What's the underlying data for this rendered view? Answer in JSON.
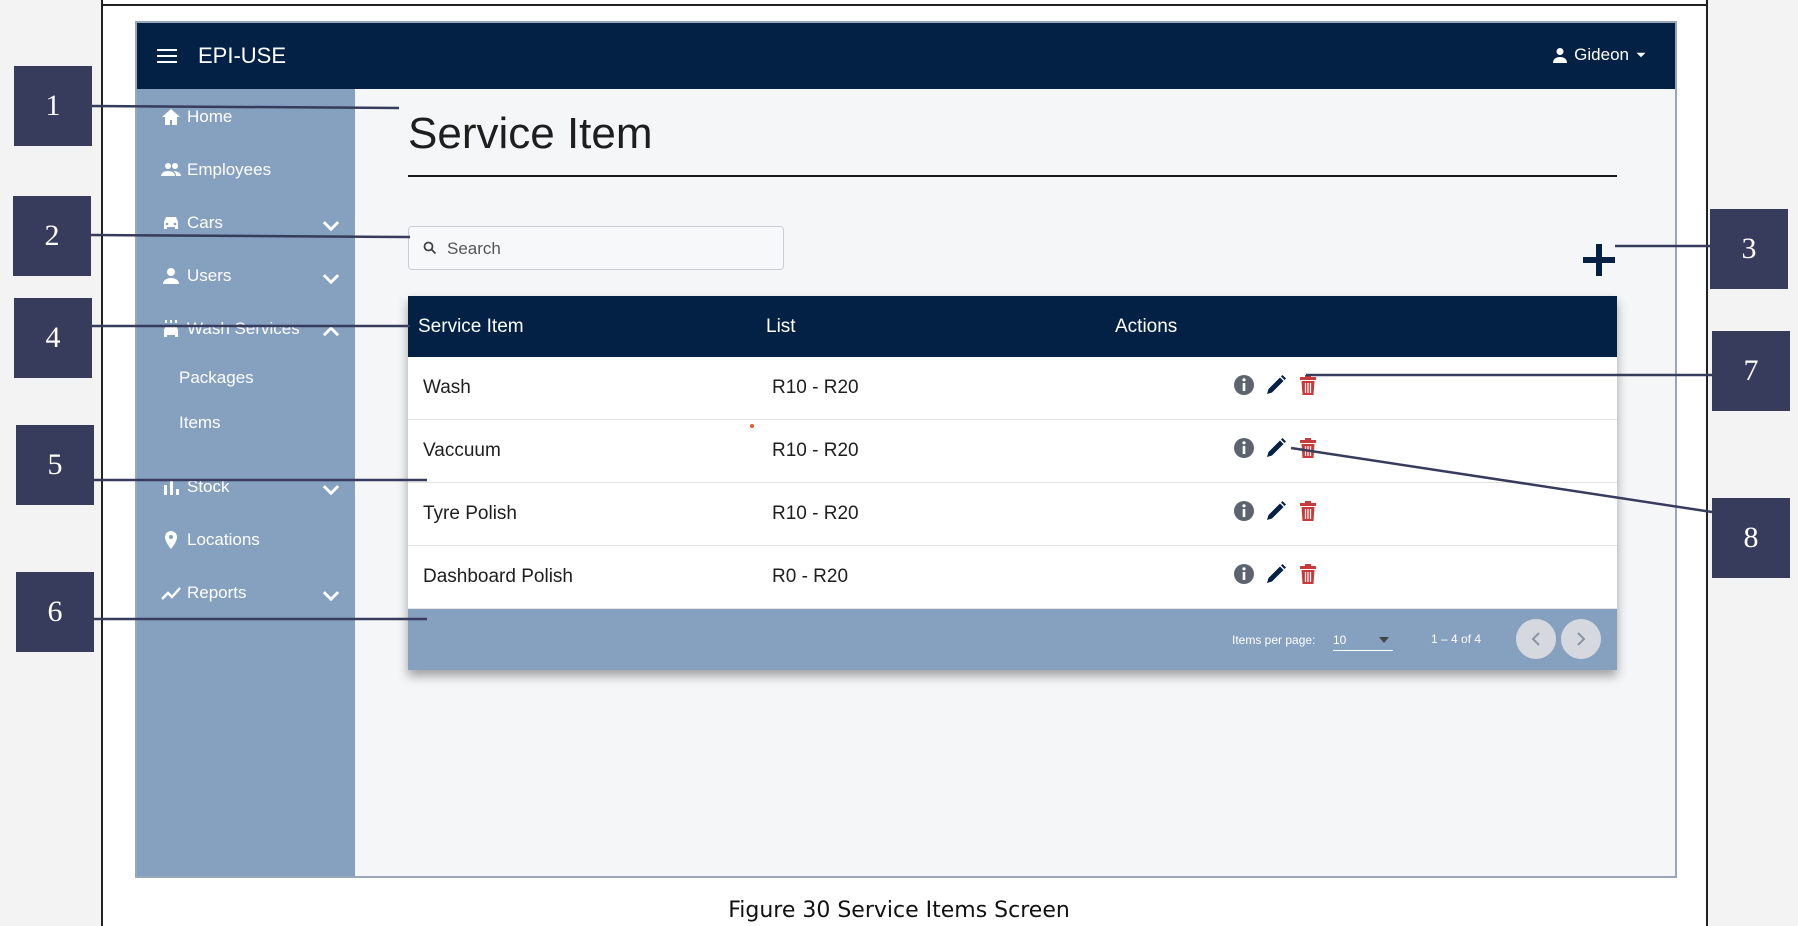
{
  "app": {
    "brand": "EPI-USE",
    "user_name": "Gideon"
  },
  "sidebar": {
    "items": [
      {
        "label": "Home",
        "icon": "home-icon"
      },
      {
        "label": "Employees",
        "icon": "people-icon"
      },
      {
        "label": "Cars",
        "icon": "car-icon"
      },
      {
        "label": "Users",
        "icon": "user-icon"
      },
      {
        "label": "Wash Services",
        "icon": "carwash-icon"
      },
      {
        "label": "Stock",
        "icon": "bar-chart-icon"
      },
      {
        "label": "Locations",
        "icon": "location-pin-icon"
      },
      {
        "label": "Reports",
        "icon": "trend-line-icon"
      }
    ],
    "sub_items": [
      {
        "label": "Packages"
      },
      {
        "label": "Items"
      }
    ]
  },
  "page": {
    "title": "Service Item"
  },
  "search": {
    "placeholder": "Search"
  },
  "table": {
    "columns": [
      "Service Item",
      "List",
      "Actions"
    ],
    "rows": [
      {
        "name": "Wash",
        "list": "R10 - R20"
      },
      {
        "name": "Vaccuum",
        "list": "R10 - R20"
      },
      {
        "name": "Tyre Polish",
        "list": "R10 - R20"
      },
      {
        "name": "Dashboard Polish",
        "list": "R0 - R20"
      }
    ]
  },
  "paginator": {
    "items_per_page_label": "Items per page:",
    "items_per_page_value": "10",
    "range_label": "1 – 4 of 4"
  },
  "callouts": [
    "1",
    "2",
    "3",
    "4",
    "5",
    "6",
    "7",
    "8"
  ],
  "caption": "Figure 30 Service Items Screen",
  "colors": {
    "navy": "#022144",
    "sidebar": "#86a0c0",
    "delete_red": "#c93a3a",
    "callout": "#383c5c"
  }
}
